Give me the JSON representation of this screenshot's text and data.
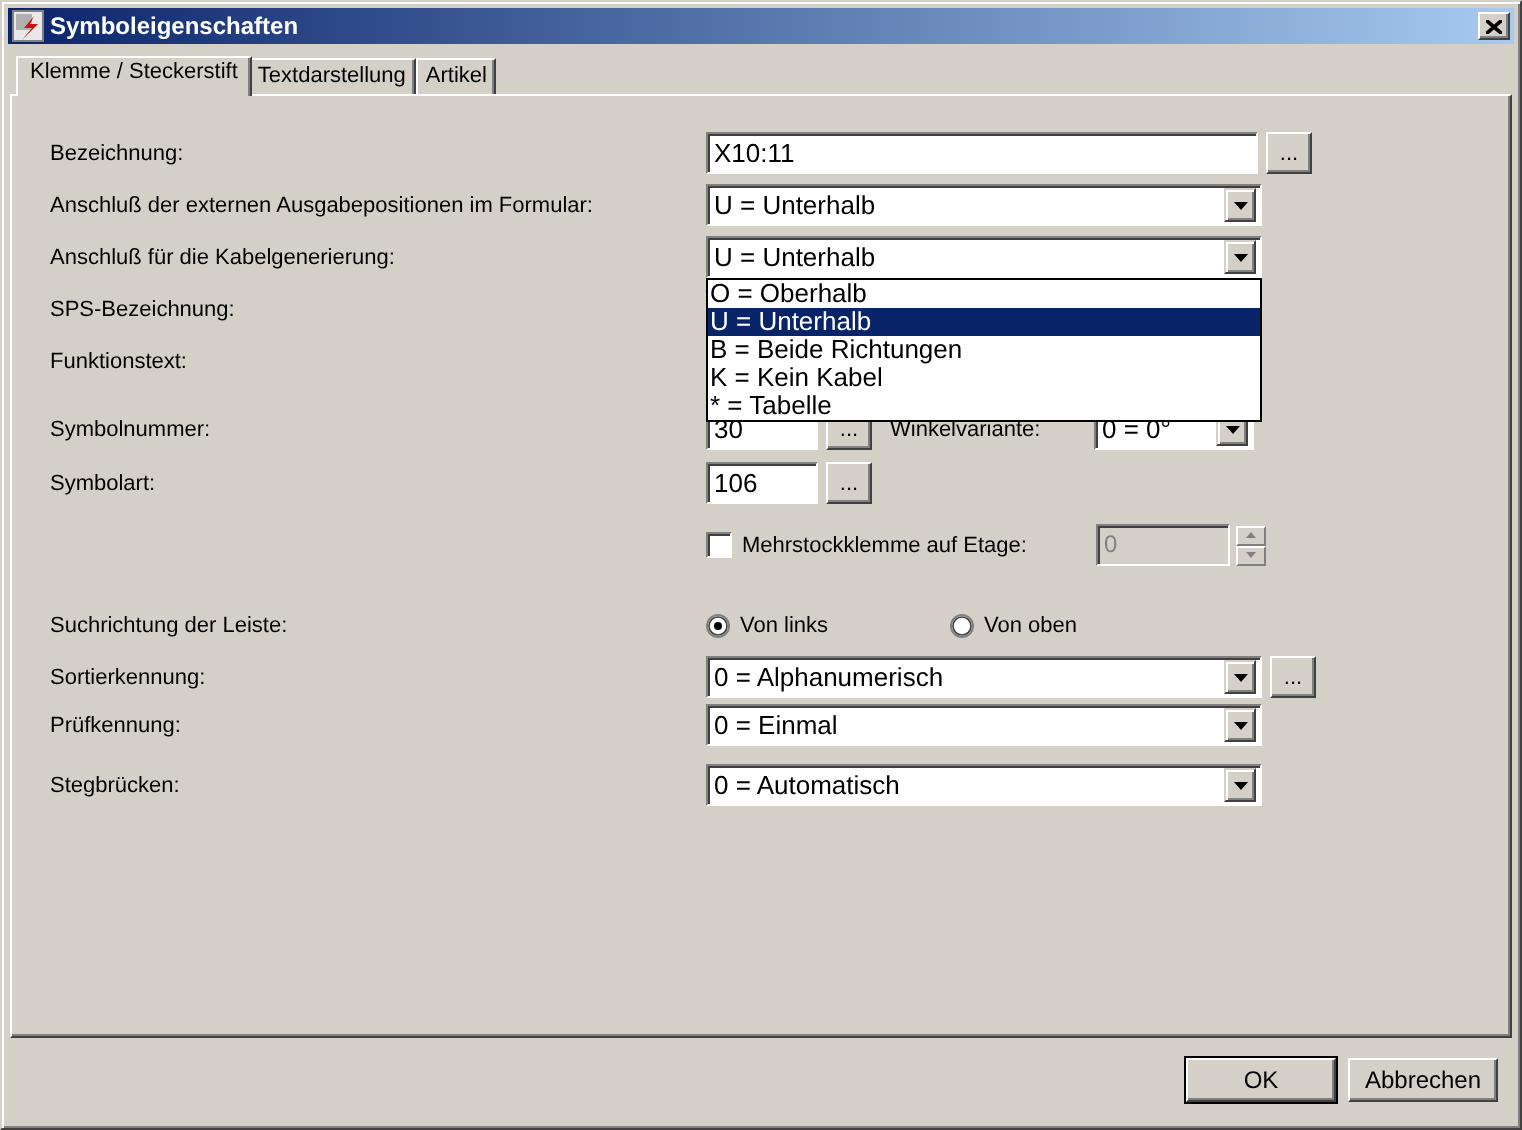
{
  "window": {
    "title": "Symboleigenschaften"
  },
  "tabs": [
    {
      "label": "Klemme / Steckerstift",
      "selected": true
    },
    {
      "label": "Textdarstellung",
      "selected": false
    },
    {
      "label": "Artikel",
      "selected": false
    }
  ],
  "rows": [
    {
      "kind": "text",
      "label": "Bezeichnung:",
      "value": "X10:11",
      "browse": "..."
    },
    {
      "kind": "combo",
      "label": "Anschluß der externen Ausgabepositionen im Formular:",
      "value": "U = Unterhalb"
    },
    {
      "kind": "combo",
      "label": "Anschluß für die Kabelgenerierung:",
      "value": "U = Unterhalb",
      "expanded": true,
      "options": [
        {
          "label": "O = Oberhalb",
          "selected": false
        },
        {
          "label": "U = Unterhalb",
          "selected": true
        },
        {
          "label": "B = Beide Richtungen",
          "selected": false
        },
        {
          "label": "K = Kein Kabel",
          "selected": false
        },
        {
          "label": "* = Tabelle",
          "selected": false
        }
      ]
    },
    {
      "kind": "label",
      "label": "SPS-Bezeichnung:"
    },
    {
      "kind": "label",
      "label": "Funktionstext:"
    },
    {
      "kind": "number",
      "label": "Symbolnummer:",
      "value": "30",
      "browse": "...",
      "extra_label": "Winkelvariante:",
      "extra_value": "0 = 0°"
    },
    {
      "kind": "number",
      "label": "Symbolart:",
      "value": "106",
      "browse": "..."
    },
    {
      "kind": "checkbox",
      "label": "Mehrstockklemme auf Etage:",
      "checked": false,
      "spin_value": "0",
      "disabled": true
    },
    {
      "kind": "radio",
      "label": "Suchrichtung der Leiste:",
      "options": [
        {
          "label": "Von links",
          "selected": true
        },
        {
          "label": "Von oben",
          "selected": false
        }
      ]
    },
    {
      "kind": "combo",
      "label": "Sortierkennung:",
      "value": "0 = Alphanumerisch",
      "browse": "..."
    },
    {
      "kind": "combo",
      "label": "Prüfkennung:",
      "value": "0 = Einmal"
    },
    {
      "kind": "combo",
      "label": "Stegbrücken:",
      "value": "0 = Automatisch"
    }
  ],
  "buttons": [
    {
      "label": "OK",
      "default": true
    },
    {
      "label": "Abbrechen",
      "default": false
    }
  ]
}
